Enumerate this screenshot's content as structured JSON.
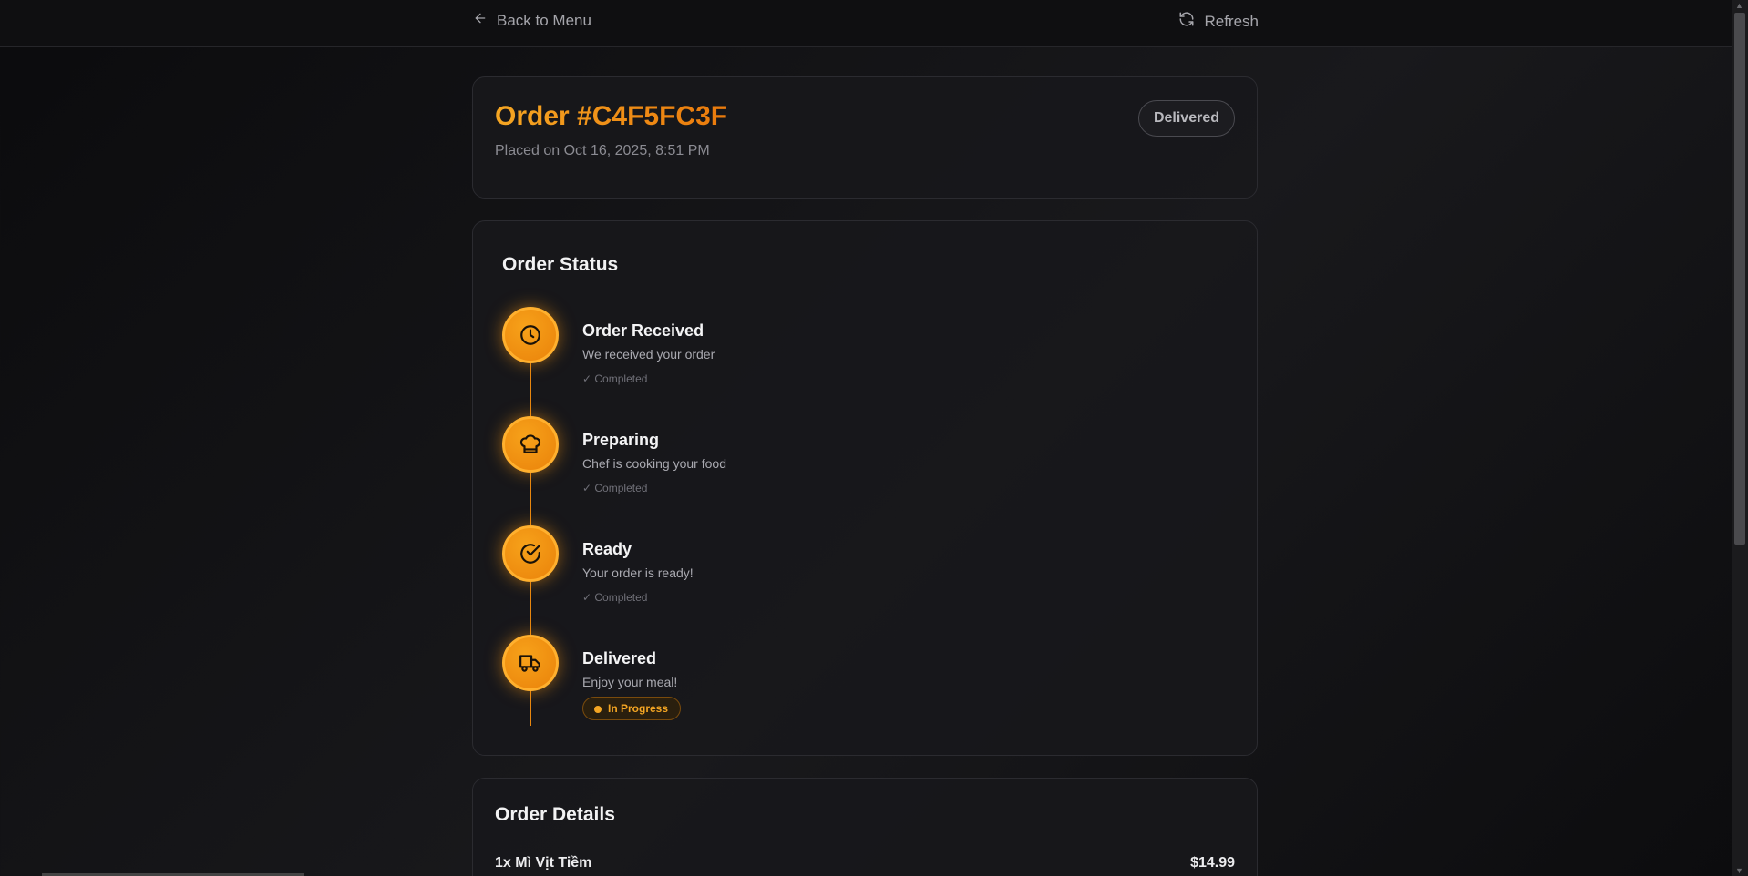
{
  "topbar": {
    "back_label": "Back to Menu",
    "refresh_label": "Refresh"
  },
  "order": {
    "title": "Order #C4F5FC3F",
    "placed": "Placed on Oct 16, 2025, 8:51 PM",
    "status": "Delivered"
  },
  "status_section": {
    "title": "Order Status",
    "steps": [
      {
        "title": "Order Received",
        "desc": "We received your order",
        "state": "✓ Completed",
        "icon": "clock-icon"
      },
      {
        "title": "Preparing",
        "desc": "Chef is cooking your food",
        "state": "✓ Completed",
        "icon": "chef-hat-icon"
      },
      {
        "title": "Ready",
        "desc": "Your order is ready!",
        "state": "✓ Completed",
        "icon": "check-circle-icon"
      },
      {
        "title": "Delivered",
        "desc": "Enjoy your meal!",
        "state": "In Progress",
        "icon": "truck-icon"
      }
    ]
  },
  "details": {
    "title": "Order Details",
    "items": [
      {
        "name": "1x Mì Vịt Tiềm",
        "price": "$14.99"
      }
    ]
  },
  "colors": {
    "accent": "#f5a623",
    "accent_dark": "#ea7a0c",
    "background": "#141416"
  }
}
